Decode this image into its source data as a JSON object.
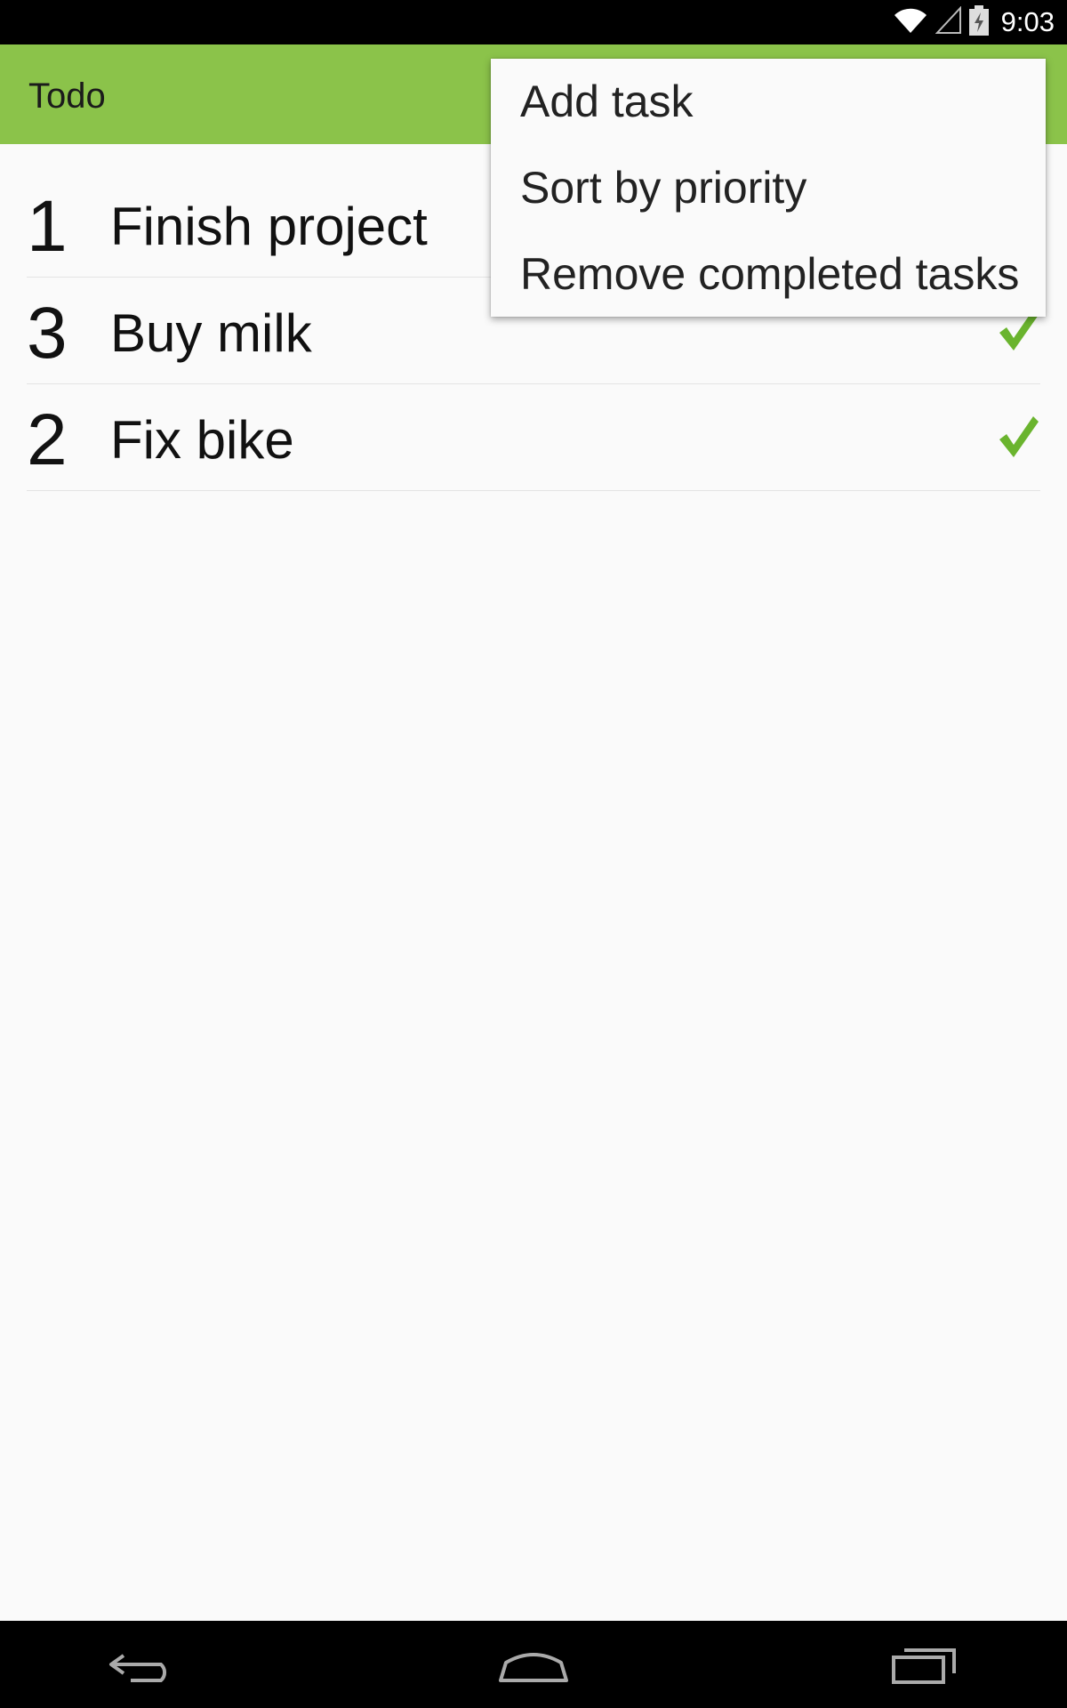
{
  "status_bar": {
    "time": "9:03",
    "icons": [
      "wifi-icon",
      "cell-signal-icon",
      "battery-charging-icon"
    ]
  },
  "app_bar": {
    "title": "Todo",
    "color": "#8bc34a"
  },
  "tasks": [
    {
      "priority": "1",
      "title": "Finish project",
      "completed": false
    },
    {
      "priority": "3",
      "title": "Buy milk",
      "completed": true
    },
    {
      "priority": "2",
      "title": "Fix bike",
      "completed": true
    }
  ],
  "overflow_menu": {
    "items": [
      "Add task",
      "Sort by priority",
      "Remove completed tasks"
    ]
  },
  "nav_bar": {
    "icons": [
      "back-icon",
      "home-icon",
      "recents-icon"
    ]
  },
  "colors": {
    "accent": "#8bc34a",
    "check": "#6ab42e"
  }
}
